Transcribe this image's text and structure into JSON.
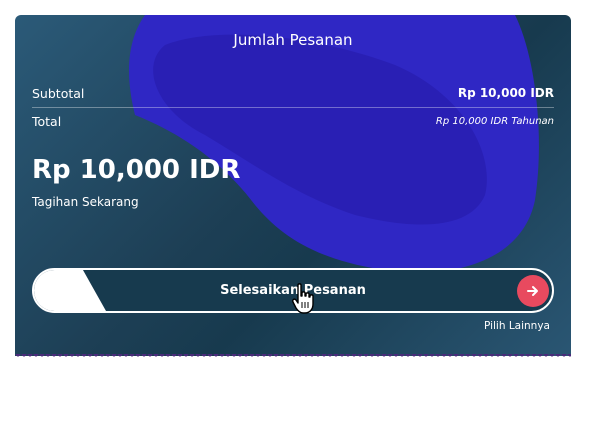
{
  "order": {
    "title": "Jumlah Pesanan",
    "subtotal_label": "Subtotal",
    "subtotal_value": "Rp 10,000 IDR",
    "total_label": "Total",
    "total_value": "Rp 10,000 IDR Tahunan",
    "amount": "Rp 10,000 IDR",
    "amount_caption": "Tagihan Sekarang"
  },
  "actions": {
    "checkout_label": "Selesaikan Pesanan",
    "checkout_icon": "arrow-right-icon",
    "more_label": "Pilih Lainnya"
  },
  "colors": {
    "card_bg": "#1d3f55",
    "blob": "#2a1fc0",
    "accent": "#e84a5f",
    "text": "#ffffff"
  }
}
